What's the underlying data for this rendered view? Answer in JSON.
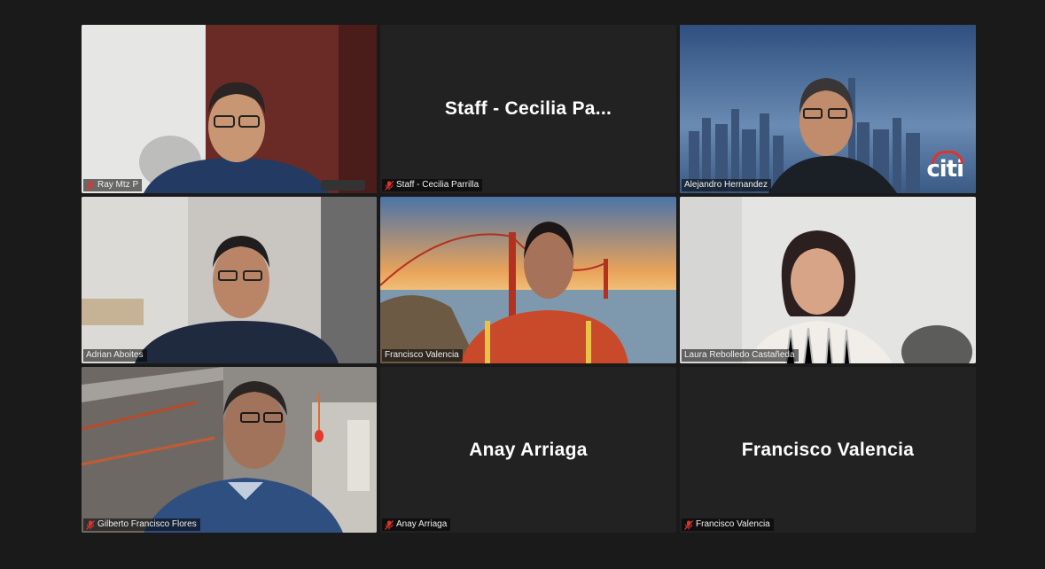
{
  "meeting": {
    "tiles": [
      {
        "id": "ray",
        "label": "Ray Mtz P",
        "muted": true,
        "video": true
      },
      {
        "id": "cecilia",
        "label": "Staff - Cecilia Parrilla",
        "display_name": "Staff - Cecilia Pa...",
        "muted": true,
        "video": false
      },
      {
        "id": "alejandro",
        "label": "Alejandro Hernandez",
        "muted": false,
        "video": true,
        "active_speaker": true,
        "logo": "citi"
      },
      {
        "id": "adrian",
        "label": "Adrian Aboites",
        "muted": false,
        "video": true
      },
      {
        "id": "francisco-video",
        "label": "Francisco Valencia",
        "muted": false,
        "video": true
      },
      {
        "id": "laura",
        "label": "Laura Rebolledo Castañeda",
        "muted": false,
        "video": true
      },
      {
        "id": "gilberto",
        "label": "Gilberto Francisco Flores",
        "muted": true,
        "video": true
      },
      {
        "id": "anay",
        "label": "Anay Arriaga",
        "display_name": "Anay Arriaga",
        "muted": true,
        "video": false
      },
      {
        "id": "francisco-off",
        "label": "Francisco Valencia",
        "display_name": "Francisco Valencia",
        "muted": true,
        "video": false
      }
    ]
  },
  "colors": {
    "background": "#1a1a1a",
    "tile_background": "#222222",
    "active_speaker_border": "#d9e37a",
    "muted_icon": "#e0352b"
  },
  "icons": {
    "muted": "mic-muted-icon"
  }
}
